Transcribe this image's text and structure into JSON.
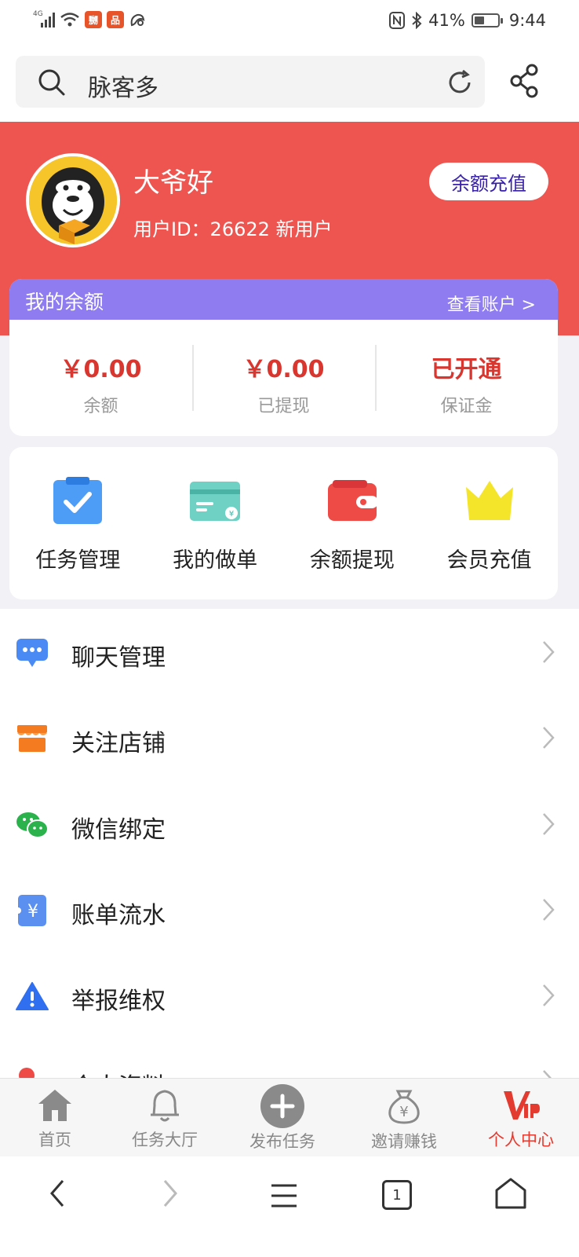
{
  "status_bar": {
    "network": "4G",
    "battery": "41%",
    "time": "9:44"
  },
  "header": {
    "search_text": "脉客多"
  },
  "profile": {
    "name": "大爷好",
    "user_id_text": "用户ID：26622 新用户",
    "recharge_button": "余额充值"
  },
  "balance": {
    "title": "我的余额",
    "view_account": "查看账户 >",
    "items": [
      {
        "value": "￥0.00",
        "label": "余额"
      },
      {
        "value": "￥0.00",
        "label": "已提现"
      },
      {
        "value": "已开通",
        "label": "保证金"
      }
    ]
  },
  "quick_actions": [
    {
      "label": "任务管理",
      "icon": "clipboard-check-icon"
    },
    {
      "label": "我的做单",
      "icon": "card-icon"
    },
    {
      "label": "余额提现",
      "icon": "wallet-icon"
    },
    {
      "label": "会员充值",
      "icon": "crown-icon"
    }
  ],
  "menu": [
    {
      "label": "聊天管理",
      "icon": "chat-icon",
      "color": "#4a8af4"
    },
    {
      "label": "关注店铺",
      "icon": "store-icon",
      "color": "#f47b20"
    },
    {
      "label": "微信绑定",
      "icon": "wechat-icon",
      "color": "#2bb24c"
    },
    {
      "label": "账单流水",
      "icon": "bill-icon",
      "color": "#5b8ff0"
    },
    {
      "label": "举报维权",
      "icon": "warning-icon",
      "color": "#2f6ff0"
    },
    {
      "label": "个人资料",
      "icon": "profile-icon",
      "color": "#ef4b46"
    }
  ],
  "tabbar": [
    {
      "label": "首页",
      "icon": "home-icon"
    },
    {
      "label": "任务大厅",
      "icon": "bell-icon"
    },
    {
      "label": "发布任务",
      "icon": "plus-circle-icon"
    },
    {
      "label": "邀请赚钱",
      "icon": "money-bag-icon"
    },
    {
      "label": "个人中心",
      "icon": "vip-icon"
    }
  ],
  "browser_nav": {
    "tab_count": "1"
  },
  "colors": {
    "banner_red": "#ef5550",
    "balance_header": "#8e7cf0",
    "amount_red": "#d9362f",
    "active_tab": "#e43b30"
  }
}
